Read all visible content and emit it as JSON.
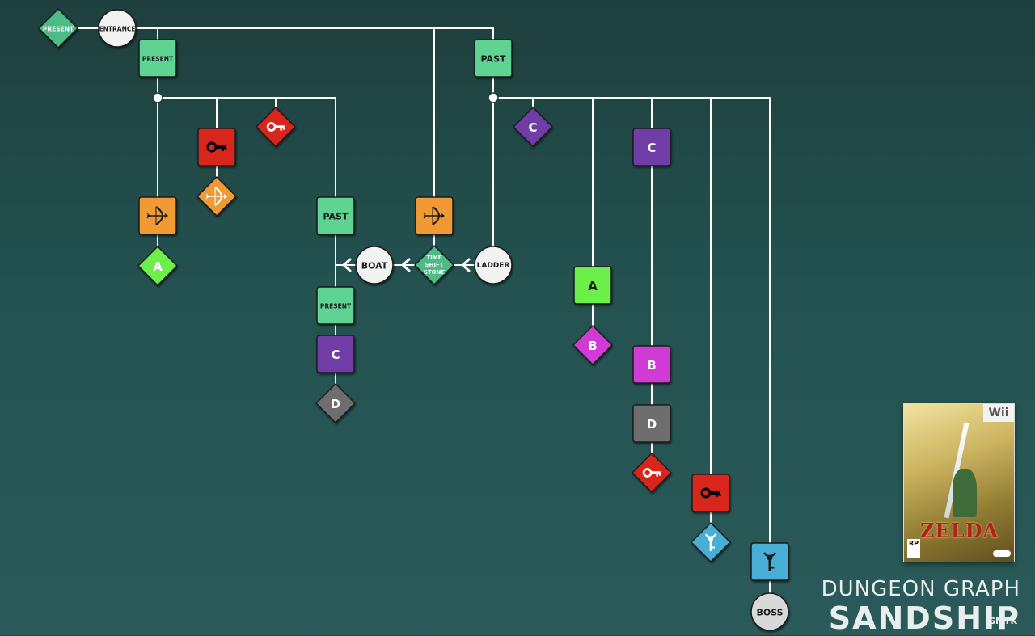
{
  "title": {
    "line1": "DUNGEON GRAPH",
    "line2": "SANDSHIP",
    "watermark": "GMTK"
  },
  "cover": {
    "platform": "Wii",
    "game_logo": "ZELDA",
    "rating": "RP"
  },
  "colors": {
    "background": "#235250",
    "edge": "#ffffff",
    "green": "#5fd391",
    "teal": "#4dbb86",
    "orange": "#f09a35",
    "red": "#d8261f",
    "purple": "#6f3da6",
    "magenta": "#d13bd5",
    "lime": "#6cf04a",
    "gray": "#6e6e6e",
    "blue": "#4aaed3"
  },
  "nodes": {
    "present_start": {
      "label": "PRESENT",
      "shape": "diamond",
      "color": "#4dbb86"
    },
    "entrance": {
      "label": "ENTRANCE",
      "shape": "circle",
      "color": "#f2f2f2"
    },
    "present_lock": {
      "label": "PRESENT",
      "shape": "square",
      "color": "#5fd391"
    },
    "past_lock_top": {
      "label": "PAST",
      "shape": "square",
      "color": "#5fd391"
    },
    "red_key_lock_left": {
      "label": "",
      "icon": "key-icon",
      "shape": "square",
      "color": "#d8261f"
    },
    "red_key_left": {
      "label": "",
      "icon": "key-icon",
      "shape": "diamond",
      "color": "#d8261f"
    },
    "bow_lock_left": {
      "label": "",
      "icon": "bow-icon",
      "shape": "square",
      "color": "#f09a35"
    },
    "bow_item_left": {
      "label": "",
      "icon": "bow-icon",
      "shape": "diamond",
      "color": "#f09a35"
    },
    "a_key_left": {
      "label": "A",
      "shape": "diamond",
      "color": "#6cf04a"
    },
    "past_lock_mid": {
      "label": "PAST",
      "shape": "square",
      "color": "#5fd391"
    },
    "bow_lock_mid": {
      "label": "",
      "icon": "bow-icon",
      "shape": "square",
      "color": "#f09a35"
    },
    "boat": {
      "label": "BOAT",
      "shape": "circle",
      "color": "#f2f2f2"
    },
    "time_shift_stone": {
      "label": "TIME SHIFT STONE",
      "lines": [
        "TIME",
        "SHIFT",
        "STONE"
      ],
      "shape": "diamond",
      "color": "#4dbb86"
    },
    "ladder": {
      "label": "LADDER",
      "shape": "circle",
      "color": "#f2f2f2"
    },
    "present_lock_mid": {
      "label": "PRESENT",
      "shape": "square",
      "color": "#5fd391"
    },
    "c_lock_mid": {
      "label": "C",
      "shape": "square",
      "color": "#6f3da6"
    },
    "d_key": {
      "label": "D",
      "shape": "diamond",
      "color": "#6e6e6e"
    },
    "c_key": {
      "label": "C",
      "shape": "diamond",
      "color": "#6f3da6"
    },
    "c_lock_right": {
      "label": "C",
      "shape": "square",
      "color": "#6f3da6"
    },
    "a_lock": {
      "label": "A",
      "shape": "square",
      "color": "#6cf04a"
    },
    "b_key": {
      "label": "B",
      "shape": "diamond",
      "color": "#d13bd5"
    },
    "b_lock": {
      "label": "B",
      "shape": "square",
      "color": "#d13bd5"
    },
    "d_lock": {
      "label": "D",
      "shape": "square",
      "color": "#6e6e6e"
    },
    "red_key_right": {
      "label": "",
      "icon": "key-icon",
      "shape": "diamond",
      "color": "#d8261f"
    },
    "red_key_lock_right": {
      "label": "",
      "icon": "key-icon",
      "shape": "square",
      "color": "#d8261f"
    },
    "boss_key": {
      "label": "",
      "icon": "boss-key-icon",
      "shape": "diamond",
      "color": "#4aaed3"
    },
    "boss_lock": {
      "label": "",
      "icon": "boss-key-icon",
      "shape": "square",
      "color": "#4aaed3"
    },
    "boss": {
      "label": "BOSS",
      "shape": "circle",
      "color": "#d9d9d9"
    }
  }
}
